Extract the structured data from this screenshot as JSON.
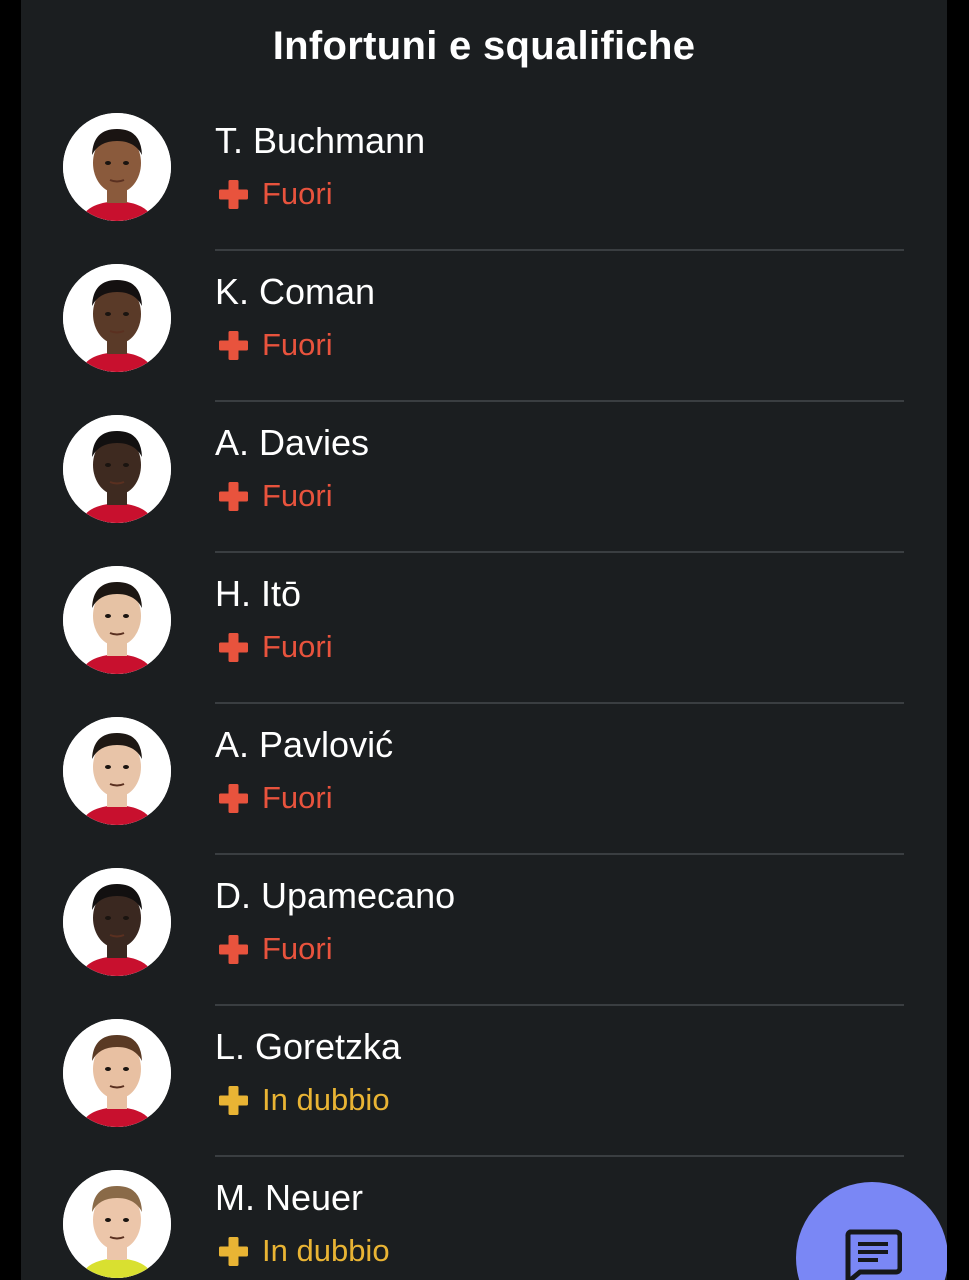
{
  "title": "Infortuni e squalifiche",
  "colors": {
    "out": "#e8533d",
    "doubtful": "#e9b434",
    "fab": "#7a87f5"
  },
  "players": [
    {
      "name": "T. Buchmann",
      "status": "Fuori",
      "status_type": "out",
      "skin": "#8a5a3c",
      "hair": "#1a1412"
    },
    {
      "name": "K. Coman",
      "status": "Fuori",
      "status_type": "out",
      "skin": "#5a3a28",
      "hair": "#141010"
    },
    {
      "name": "A. Davies",
      "status": "Fuori",
      "status_type": "out",
      "skin": "#3e2a20",
      "hair": "#121010"
    },
    {
      "name": "H. Itō",
      "status": "Fuori",
      "status_type": "out",
      "skin": "#e6c2a4",
      "hair": "#1c1612"
    },
    {
      "name": "A. Pavlović",
      "status": "Fuori",
      "status_type": "out",
      "skin": "#e8c4a8",
      "hair": "#1e1814"
    },
    {
      "name": "D. Upamecano",
      "status": "Fuori",
      "status_type": "out",
      "skin": "#3a2820",
      "hair": "#121010"
    },
    {
      "name": "L. Goretzka",
      "status": "In dubbio",
      "status_type": "doubtful",
      "skin": "#e8c0a2",
      "hair": "#5a3a24"
    },
    {
      "name": "M. Neuer",
      "status": "In dubbio",
      "status_type": "doubtful",
      "skin": "#ecc6aa",
      "hair": "#8a6a48"
    }
  ],
  "fab": {
    "icon": "chat-icon"
  }
}
